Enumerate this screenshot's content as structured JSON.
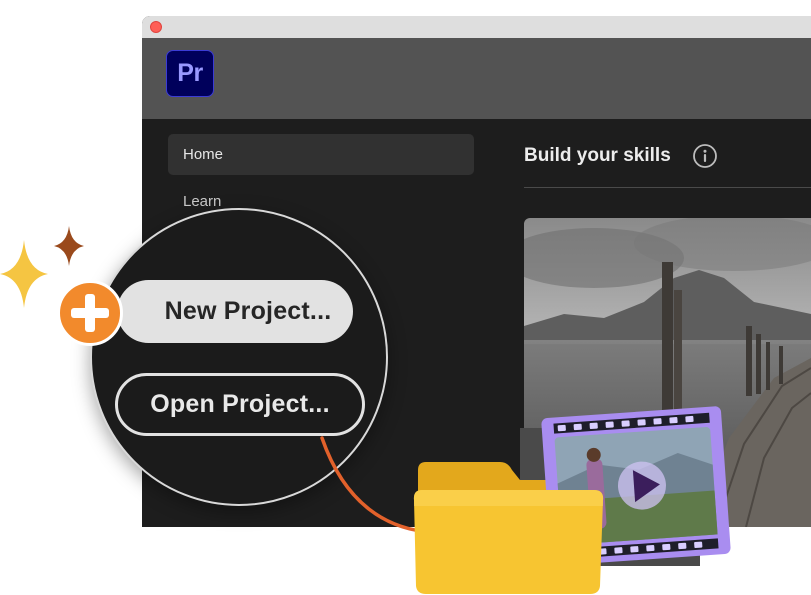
{
  "app": {
    "logo_text": "Pr",
    "accent": "#9999ff",
    "logo_bg": "#00005b"
  },
  "sidebar": {
    "items": [
      {
        "label": "Home",
        "selected": true
      },
      {
        "label": "Learn",
        "selected": false
      }
    ]
  },
  "main": {
    "section_title": "Build your skills",
    "info_icon": "info-icon"
  },
  "callout": {
    "new_project_label": "New Project...",
    "open_project_label": "Open Project...",
    "plus_badge_color": "#f28a2c",
    "arrow_color": "#e2612b",
    "sparkle_colors": [
      "#f5c542",
      "#9a4a1c"
    ]
  },
  "illustration": {
    "folder_color": "#f7c531",
    "filmstrip_color": "#a98df0",
    "play_icon": "play-icon"
  }
}
